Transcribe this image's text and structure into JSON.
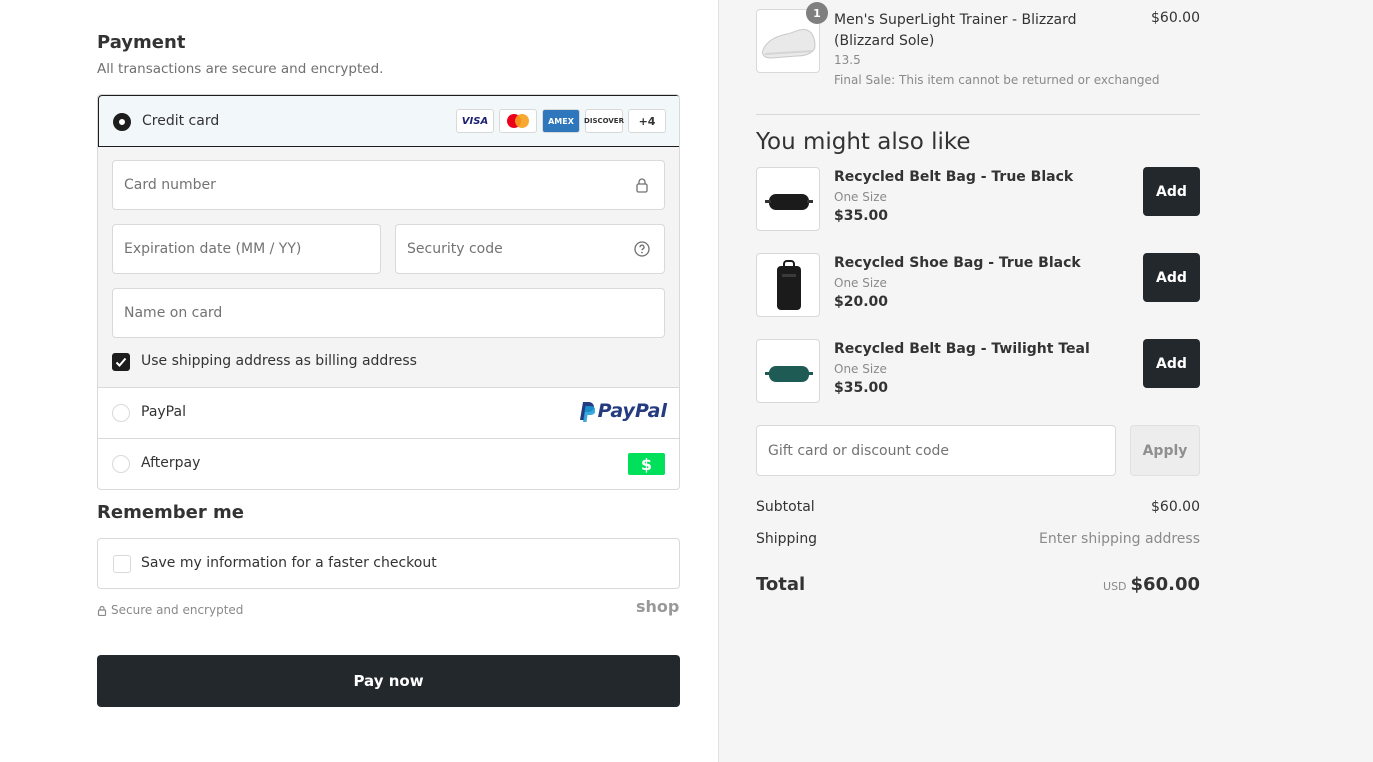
{
  "payment": {
    "title": "Payment",
    "subtitle": "All transactions are secure and encrypted.",
    "methods": {
      "credit_card": {
        "label": "Credit card",
        "brands": [
          "VISA",
          "MC",
          "AMEX",
          "DISCOVER",
          "+4"
        ]
      },
      "paypal": {
        "label": "PayPal",
        "logo_text": "PayPal"
      },
      "afterpay": {
        "label": "Afterpay",
        "logo_text": "$"
      }
    },
    "fields": {
      "card_number": "Card number",
      "expiration": "Expiration date (MM / YY)",
      "security_code": "Security code",
      "name_on_card": "Name on card"
    },
    "billing_same_label": "Use shipping address as billing address",
    "billing_same_checked": true
  },
  "remember": {
    "title": "Remember me",
    "save_label": "Save my information for a faster checkout",
    "checked": false
  },
  "secure_note": "Secure and encrypted",
  "shop_logo": "shop",
  "pay_button": "Pay now",
  "cart": {
    "item": {
      "qty": "1",
      "name": "Men's SuperLight Trainer - Blizzard (Blizzard Sole)",
      "size": "13.5",
      "note": "Final Sale: This item cannot be returned or exchanged",
      "price": "$60.00"
    }
  },
  "suggestions": {
    "title": "You might also like",
    "items": [
      {
        "name": "Recycled Belt Bag - True Black",
        "size": "One Size",
        "price": "$35.00",
        "add": "Add"
      },
      {
        "name": "Recycled Shoe Bag - True Black",
        "size": "One Size",
        "price": "$20.00",
        "add": "Add"
      },
      {
        "name": "Recycled Belt Bag - Twilight Teal",
        "size": "One Size",
        "price": "$35.00",
        "add": "Add"
      }
    ]
  },
  "discount": {
    "placeholder": "Gift card or discount code",
    "apply": "Apply"
  },
  "summary": {
    "subtotal_label": "Subtotal",
    "subtotal_value": "$60.00",
    "shipping_label": "Shipping",
    "shipping_value": "Enter shipping address",
    "total_label": "Total",
    "currency": "USD",
    "total_value": "$60.00"
  },
  "colors": {
    "accent_dark": "#22282c",
    "paypal_blue": "#253b80",
    "paypal_light": "#179bd7",
    "afterpay_green": "#00e05a",
    "teal_bag": "#1f5b55"
  }
}
